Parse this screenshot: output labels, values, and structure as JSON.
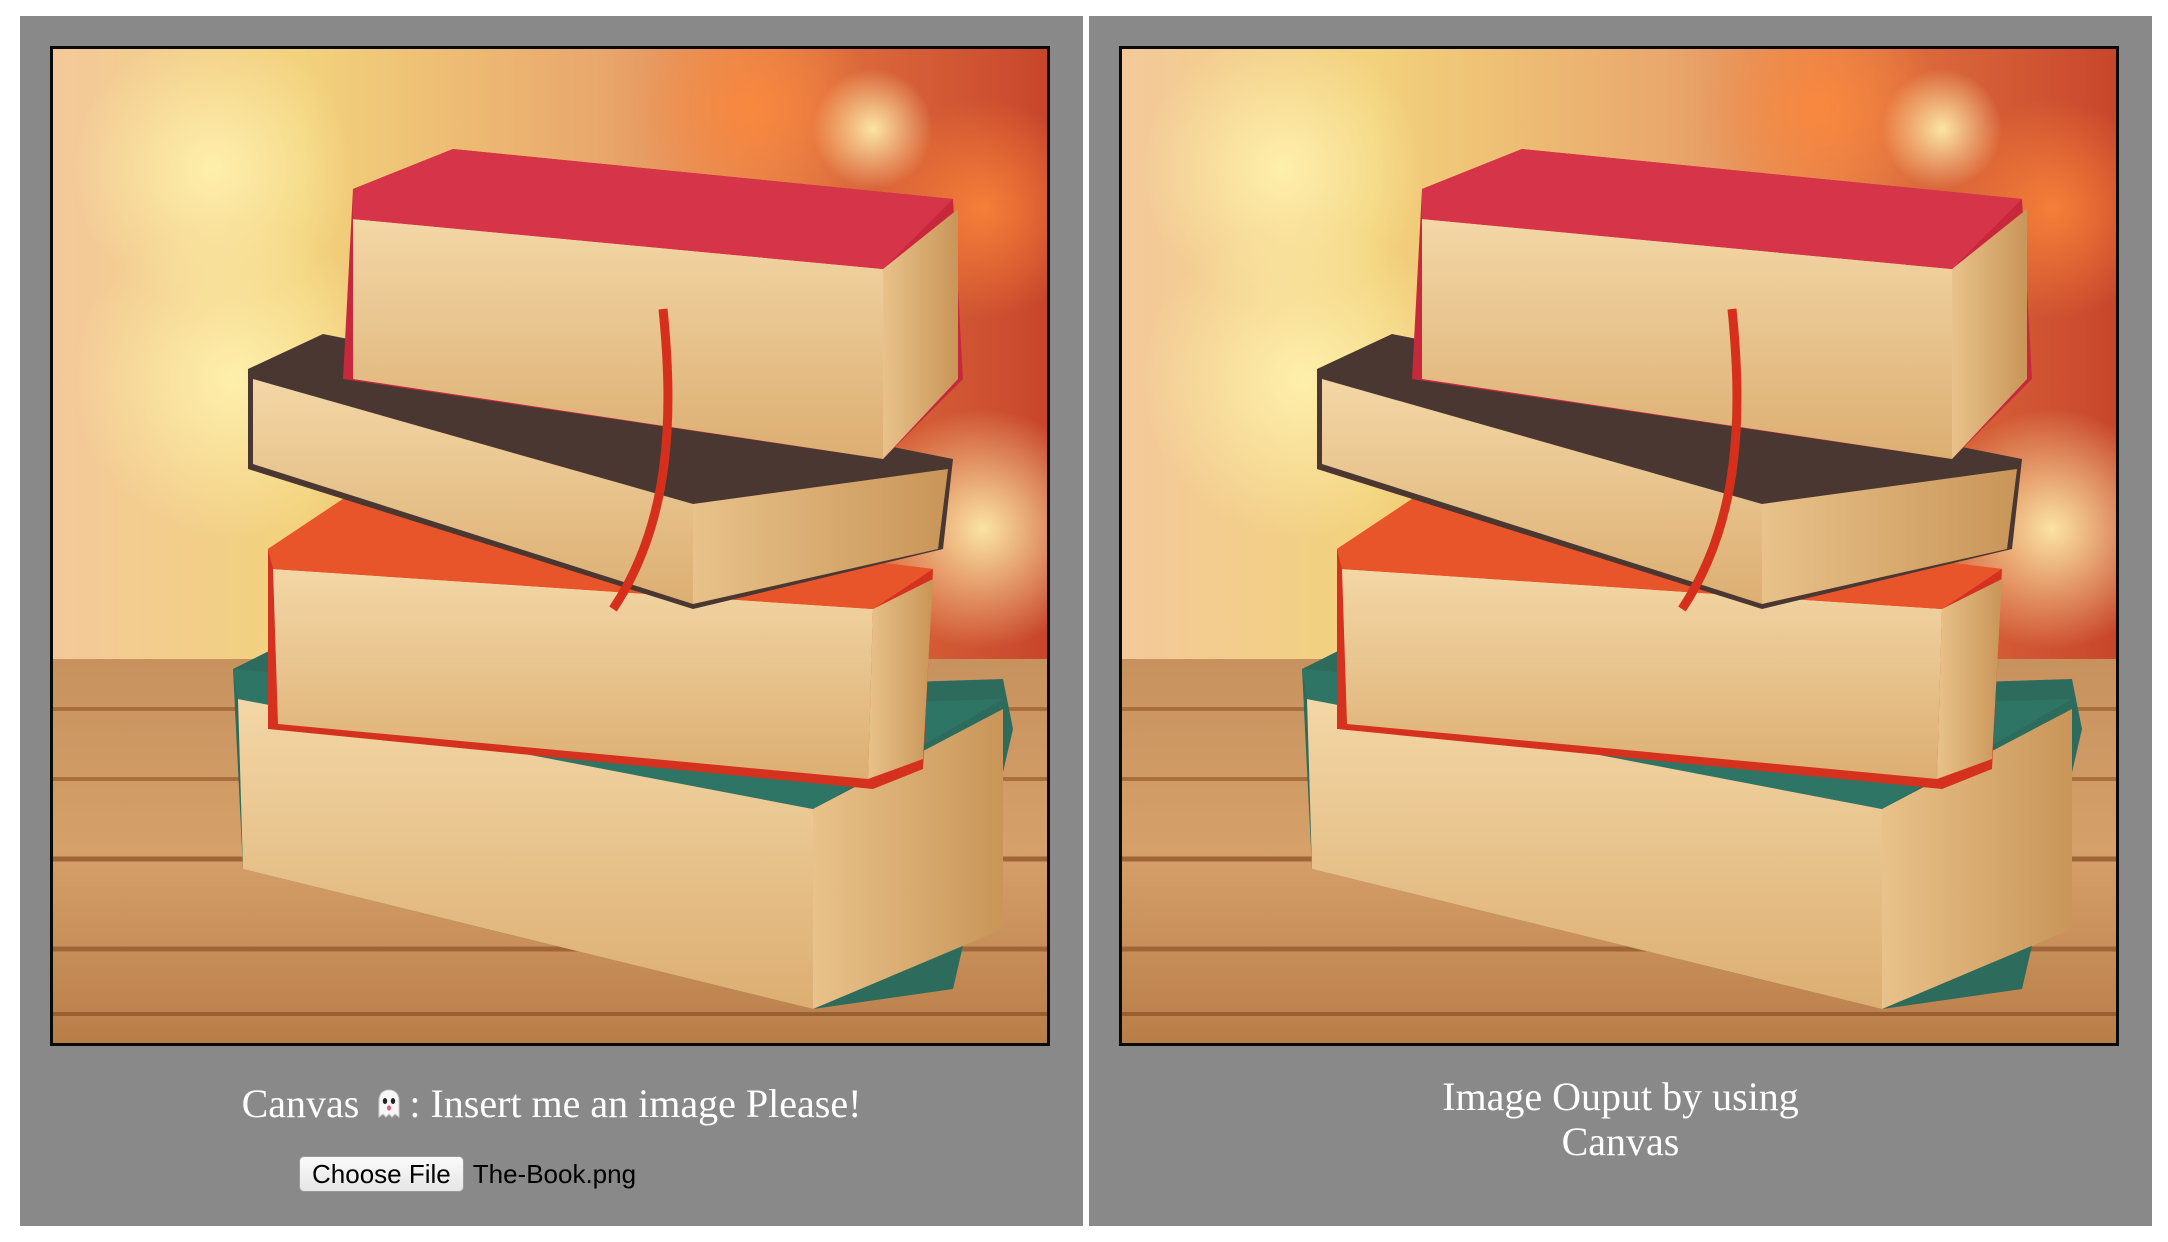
{
  "left_panel": {
    "canvas_image": "stack of four books on wooden table",
    "caption_prefix": "Canvas",
    "caption_icon": "ghost-icon",
    "caption_suffix": ": Insert me an image Please!",
    "file_input": {
      "button_label": "Choose File",
      "file_name": "The-Book.png"
    }
  },
  "right_panel": {
    "canvas_image": "stack of four books on wooden table",
    "caption": "Image Ouput by using Canvas"
  },
  "colors": {
    "panel_background": "#898989",
    "caption_text": "#ffffff",
    "canvas_border": "#0a0a0a"
  }
}
